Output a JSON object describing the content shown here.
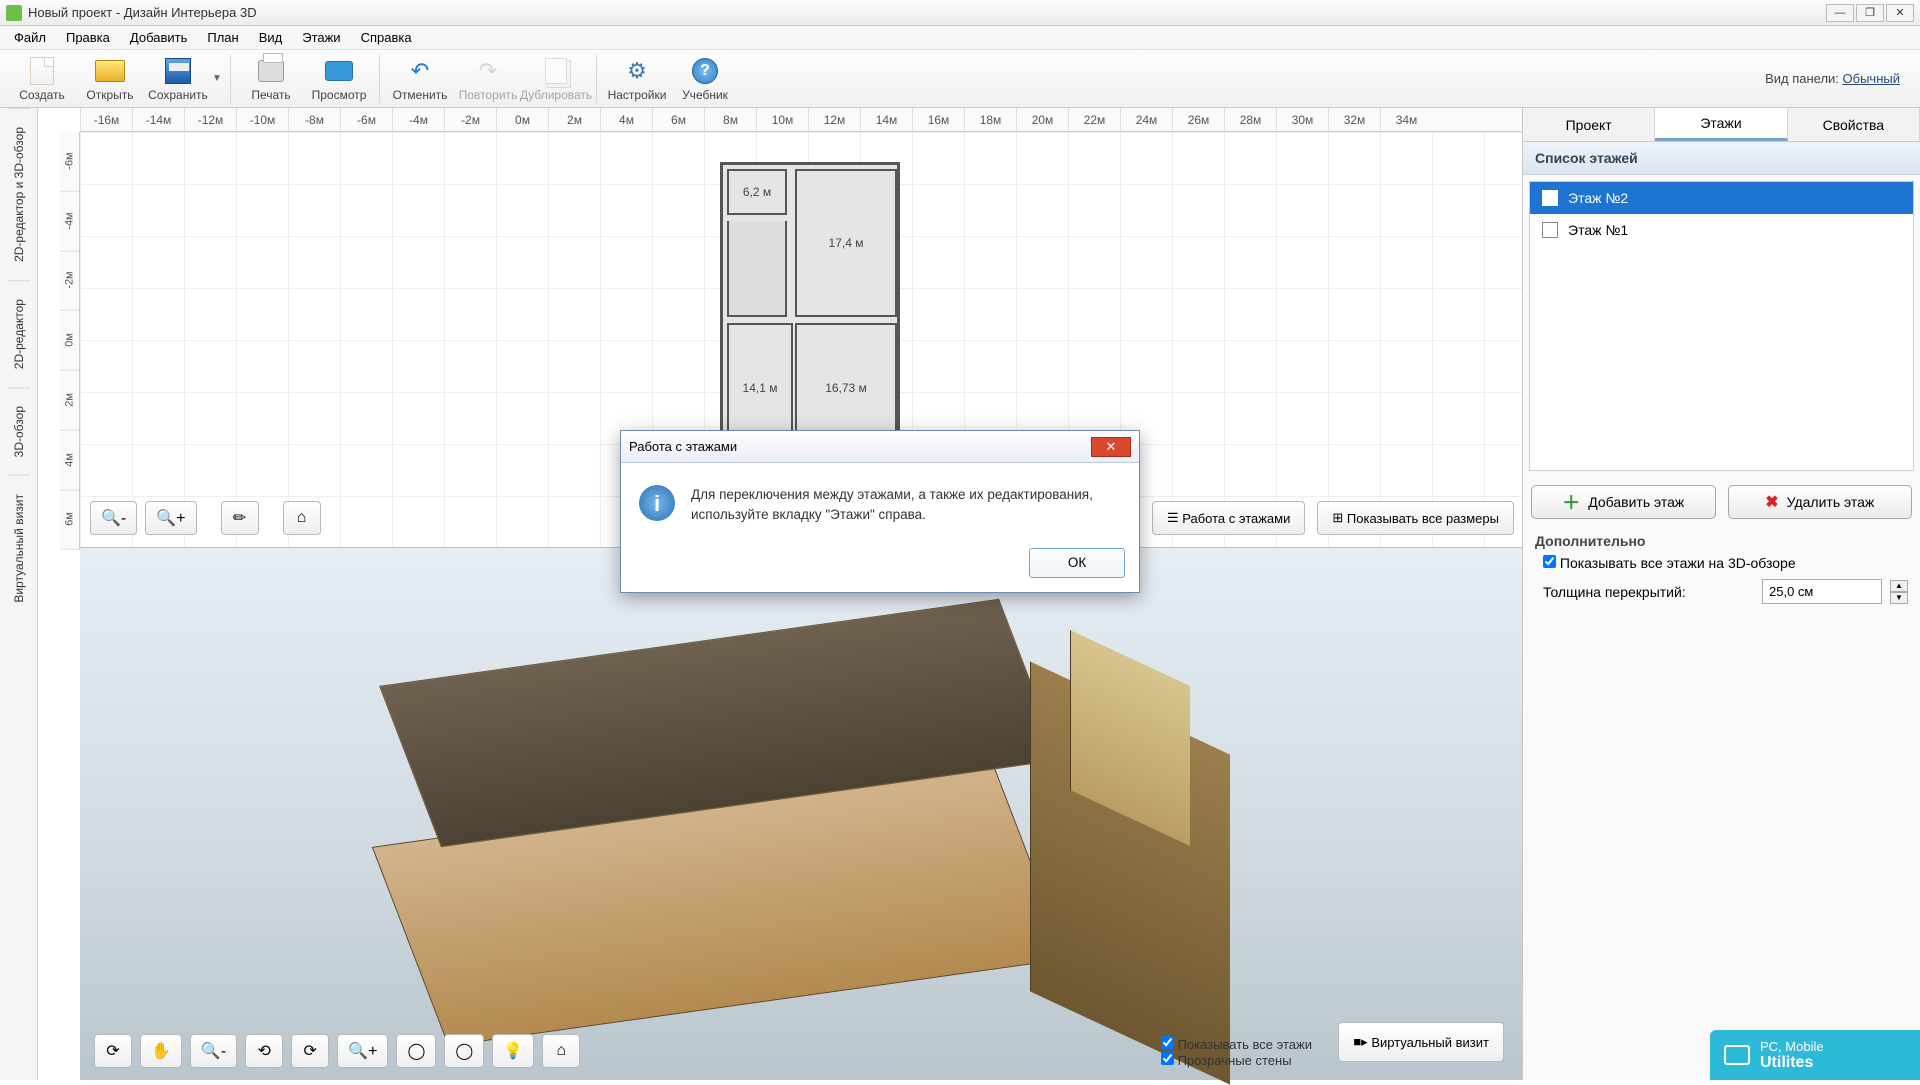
{
  "title": "Новый проект - Дизайн Интерьера 3D",
  "menu": {
    "file": "Файл",
    "edit": "Правка",
    "add": "Добавить",
    "plan": "План",
    "view": "Вид",
    "floors": "Этажи",
    "help": "Справка"
  },
  "toolbar": {
    "create": "Создать",
    "open": "Открыть",
    "save": "Сохранить",
    "print": "Печать",
    "preview": "Просмотр",
    "undo": "Отменить",
    "redo": "Повторить",
    "duplicate": "Дублировать",
    "settings": "Настройки",
    "tutorial": "Учебник",
    "view_mode_label": "Вид панели:",
    "view_mode_value": "Обычный"
  },
  "vtabs": {
    "t1": "2D-редактор и 3D-обзор",
    "t2": "2D-редактор",
    "t3": "3D-обзор",
    "t4": "Виртуальный визит"
  },
  "ruler_h": [
    "-16м",
    "-14м",
    "-12м",
    "-10м",
    "-8м",
    "-6м",
    "-4м",
    "-2м",
    "0м",
    "2м",
    "4м",
    "6м",
    "8м",
    "10м",
    "12м",
    "14м",
    "16м",
    "18м",
    "20м",
    "22м",
    "24м",
    "26м",
    "28м",
    "30м",
    "32м",
    "34м"
  ],
  "ruler_v": [
    "-6м",
    "-4м",
    "-2м",
    "0м",
    "2м",
    "4м",
    "6м"
  ],
  "plan": {
    "r1": "6,2 м",
    "r2": "17,4 м",
    "r4": "14,1 м",
    "r5": "16,73 м"
  },
  "overlay": {
    "floors_btn": "Работа с этажами",
    "dims_btn": "Показывать все размеры"
  },
  "checks3d": {
    "all_floors": "Показывать все этажи",
    "transparent": "Прозрачные стены"
  },
  "virtual_visit": "Виртуальный визит",
  "side": {
    "tab_project": "Проект",
    "tab_floors": "Этажи",
    "tab_props": "Свойства",
    "list_header": "Список этажей",
    "floors": [
      {
        "label": "Этаж №2"
      },
      {
        "label": "Этаж №1"
      }
    ],
    "add": "Добавить этаж",
    "del": "Удалить этаж",
    "extra": "Дополнительно",
    "show_all_3d": "Показывать все этажи на 3D-обзоре",
    "thickness_label": "Толщина перекрытий:",
    "thickness_value": "25,0 см"
  },
  "dialog": {
    "title": "Работа с этажами",
    "body": "Для переключения между этажами, а также их редактирования, используйте вкладку \"Этажи\" справа.",
    "ok": "ОК"
  },
  "watermark": {
    "l1": "PC, Mobile",
    "l2": "Utilites"
  }
}
